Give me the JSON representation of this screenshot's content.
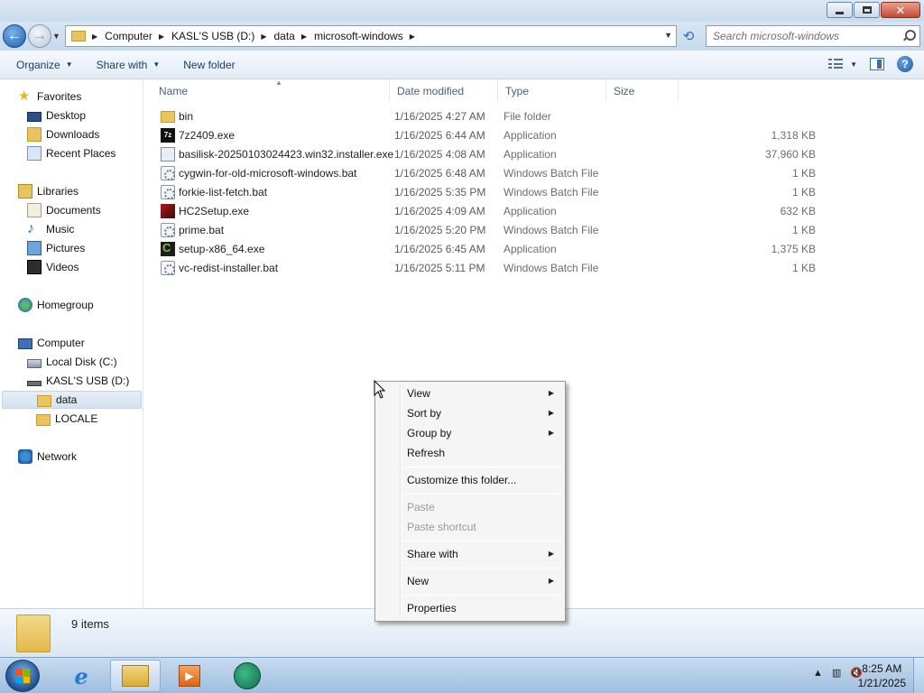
{
  "address": {
    "crumbs": [
      "Computer",
      "KASL'S USB (D:)",
      "data",
      "microsoft-windows"
    ],
    "search_placeholder": "Search microsoft-windows"
  },
  "commandbar": {
    "organize": "Organize",
    "share_with": "Share with",
    "new_folder": "New folder"
  },
  "nav": {
    "favorites": "Favorites",
    "desktop": "Desktop",
    "downloads": "Downloads",
    "recent_places": "Recent Places",
    "libraries": "Libraries",
    "documents": "Documents",
    "music": "Music",
    "pictures": "Pictures",
    "videos": "Videos",
    "homegroup": "Homegroup",
    "computer": "Computer",
    "local_disk": "Local Disk (C:)",
    "usb": "KASL'S USB (D:)",
    "data": "data",
    "locale": "LOCALE",
    "network": "Network"
  },
  "columns": {
    "name": "Name",
    "date": "Date modified",
    "type": "Type",
    "size": "Size"
  },
  "files": [
    {
      "name": "bin",
      "date": "1/16/2025 4:27 AM",
      "type": "File folder",
      "size": "",
      "icon": "folder-icon"
    },
    {
      "name": "7z2409.exe",
      "date": "1/16/2025 6:44 AM",
      "type": "Application",
      "size": "1,318 KB",
      "icon": "7zip-icon"
    },
    {
      "name": "basilisk-20250103024423.win32.installer.exe",
      "date": "1/16/2025 4:08 AM",
      "type": "Application",
      "size": "37,960 KB",
      "icon": "installer-icon"
    },
    {
      "name": "cygwin-for-old-microsoft-windows.bat",
      "date": "1/16/2025 6:48 AM",
      "type": "Windows Batch File",
      "size": "1 KB",
      "icon": "batch-file-icon"
    },
    {
      "name": "forkie-list-fetch.bat",
      "date": "1/16/2025 5:35 PM",
      "type": "Windows Batch File",
      "size": "1 KB",
      "icon": "batch-file-icon"
    },
    {
      "name": "HC2Setup.exe",
      "date": "1/16/2025 4:09 AM",
      "type": "Application",
      "size": "632 KB",
      "icon": "hc2-icon"
    },
    {
      "name": "prime.bat",
      "date": "1/16/2025 5:20 PM",
      "type": "Windows Batch File",
      "size": "1 KB",
      "icon": "batch-file-icon"
    },
    {
      "name": "setup-x86_64.exe",
      "date": "1/16/2025 6:45 AM",
      "type": "Application",
      "size": "1,375 KB",
      "icon": "cygwin-icon"
    },
    {
      "name": "vc-redist-installer.bat",
      "date": "1/16/2025 5:11 PM",
      "type": "Windows Batch File",
      "size": "1 KB",
      "icon": "batch-file-icon"
    }
  ],
  "context_menu": {
    "view": "View",
    "sort_by": "Sort by",
    "group_by": "Group by",
    "refresh": "Refresh",
    "customize": "Customize this folder...",
    "paste": "Paste",
    "paste_shortcut": "Paste shortcut",
    "share_with": "Share with",
    "new": "New",
    "properties": "Properties"
  },
  "details": {
    "count": "9 items"
  },
  "taskbar": {
    "time": "8:25 AM",
    "date": "1/21/2025"
  }
}
